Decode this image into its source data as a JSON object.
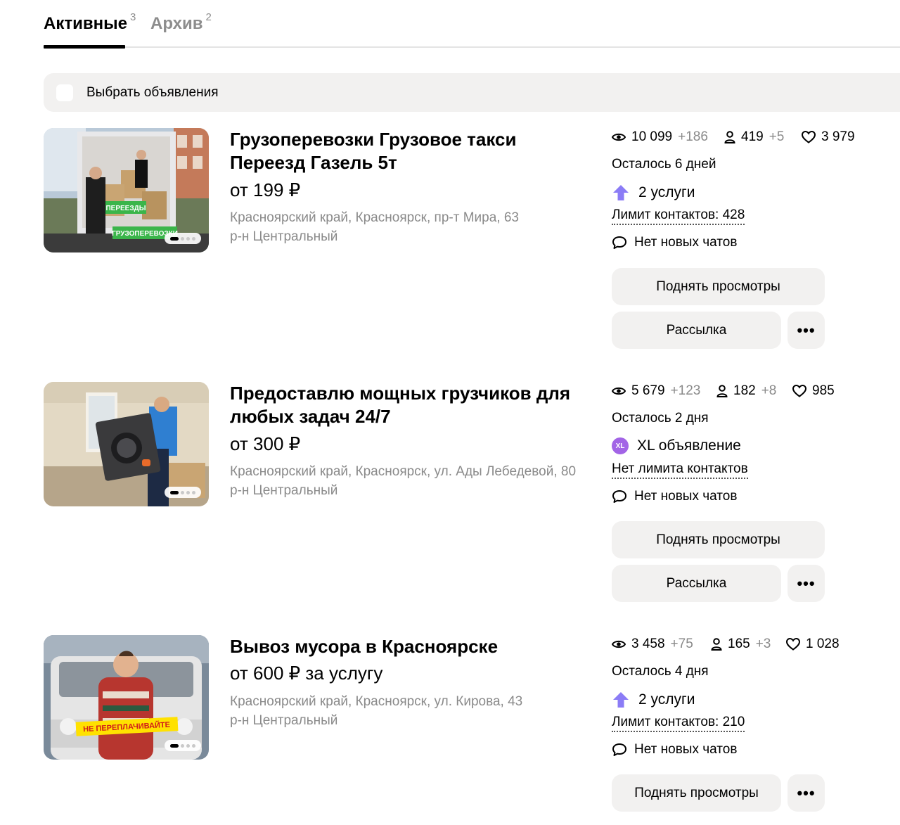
{
  "tabs": [
    {
      "label": "Активные",
      "count": "3"
    },
    {
      "label": "Архив",
      "count": "2"
    }
  ],
  "select_bar": {
    "label": "Выбрать объявления"
  },
  "listings": [
    {
      "title": "Грузоперевозки Грузовое такси Переезд Газель 5т",
      "price": "от 199 ₽",
      "address_line1": "Красноярский край, Красноярск, пр-т Мира, 63",
      "address_line2": "р-н Центральный",
      "views": "10 099",
      "views_plus": "+186",
      "contacts": "419",
      "contacts_plus": "+5",
      "favorites": "3 979",
      "remaining": "Осталось 6 дней",
      "service_icon": "arrow-up-icon",
      "service": "2 услуги",
      "limit": "Лимит контактов: 428",
      "chats": "Нет новых чатов",
      "raise_label": "Поднять просмотры",
      "mailing_label": "Рассылка",
      "more_label": "•••",
      "photo_labels": [
        "ПЕРЕЕЗДЫ",
        "ГРУЗОПЕРЕВОЗКИ"
      ]
    },
    {
      "title": "Предоставлю мощных грузчиков для любых задач 24/7",
      "price": "от 300 ₽",
      "address_line1": "Красноярский край, Красноярск, ул. Ады Лебедевой, 80",
      "address_line2": "р-н Центральный",
      "views": "5 679",
      "views_plus": "+123",
      "contacts": "182",
      "contacts_plus": "+8",
      "favorites": "985",
      "remaining": "Осталось 2 дня",
      "service_icon": "xl-badge-icon",
      "service_badge": "XL",
      "service": "XL объявление",
      "limit": "Нет лимита контактов",
      "chats": "Нет новых чатов",
      "raise_label": "Поднять просмотры",
      "mailing_label": "Рассылка",
      "more_label": "•••"
    },
    {
      "title": "Вывоз мусора в Красноярске",
      "price": "от 600 ₽ за услугу",
      "address_line1": "Красноярский край, Красноярск, ул. Кирова, 43",
      "address_line2": "р-н Центральный",
      "views": "3 458",
      "views_plus": "+75",
      "contacts": "165",
      "contacts_plus": "+3",
      "favorites": "1 028",
      "remaining": "Осталось 4 дня",
      "service_icon": "arrow-up-icon",
      "service": "2 услуги",
      "limit": "Лимит контактов: 210",
      "chats": "Нет новых чатов",
      "raise_label": "Поднять просмотры",
      "more_label": "•••",
      "photo_labels": [
        "НЕ ПЕРЕПЛАЧИВАЙТЕ"
      ]
    }
  ],
  "colors": {
    "accent_arrow": "#8b7cf6",
    "xl_badge": "#a264e6",
    "button_bg": "#f2f1f0",
    "muted_text": "#8a8a8a"
  }
}
